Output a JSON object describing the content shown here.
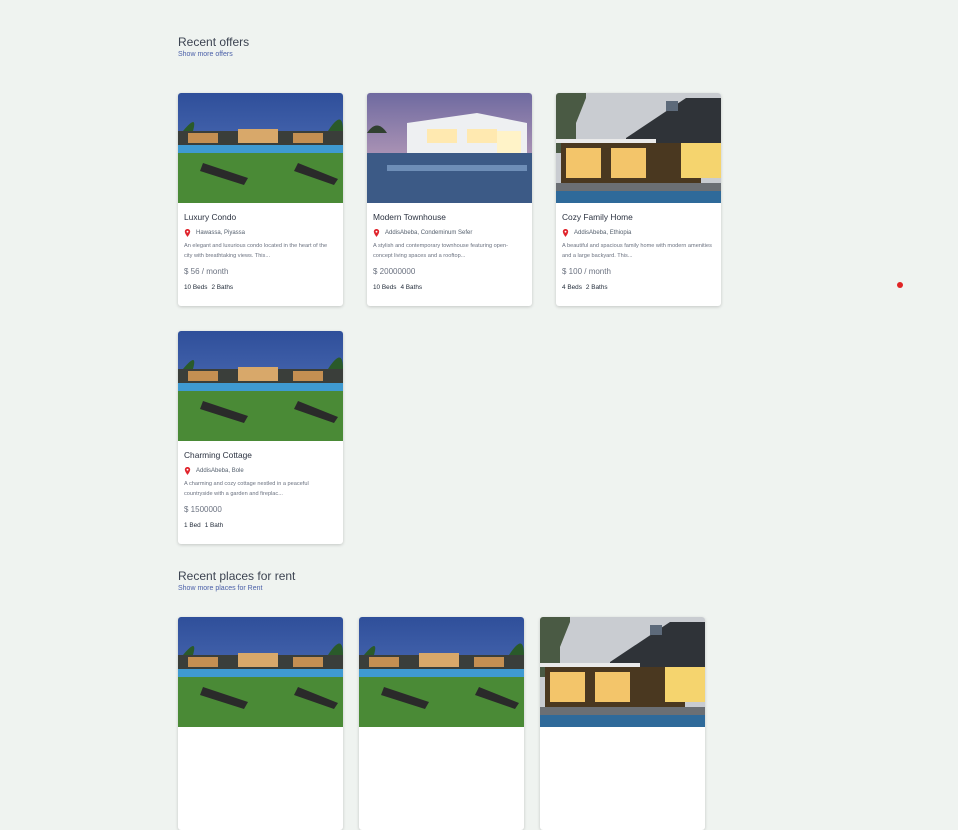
{
  "sections": {
    "offers": {
      "title": "Recent offers",
      "link": "Show more offers"
    },
    "rent": {
      "title": "Recent places for rent",
      "link": "Show more places for Rent"
    }
  },
  "offers": [
    {
      "title": "Luxury Condo",
      "location": "Hawassa, Piyassa",
      "description": "An elegant and luxurious condo located in the heart of the city with breathtaking views. This...",
      "price": "$ 56 / month",
      "beds": "10 Beds",
      "baths": "2 Baths",
      "image": "pool-villa-photo"
    },
    {
      "title": "Modern Townhouse",
      "location": "AddisAbeba, Condeminum Sefer",
      "description": "A stylish and contemporary townhouse featuring open-concept living spaces and a rooftop...",
      "price": "$ 20000000",
      "beds": "10 Beds",
      "baths": "4 Baths",
      "image": "white-villa-pool-photo"
    },
    {
      "title": "Cozy Family Home",
      "location": "AddisAbeba, Ethiopia",
      "description": "A beautiful and spacious family home with modern amenities and a large backyard. This...",
      "price": "$ 100 / month",
      "beds": "4 Beds",
      "baths": "2 Baths",
      "image": "modern-house-photo"
    },
    {
      "title": "Charming Cottage",
      "location": "AddisAbeba, Bole",
      "description": "A charming and cozy cottage nestled in a peaceful countryside with a garden and fireplac...",
      "price": "$ 1500000",
      "beds": "1 Bed",
      "baths": "1 Bath",
      "image": "pool-villa-photo"
    }
  ],
  "colors": {
    "background": "#eff3f0",
    "link": "#4a5fa8",
    "pin": "#e0242c",
    "dot": "#e02424"
  }
}
